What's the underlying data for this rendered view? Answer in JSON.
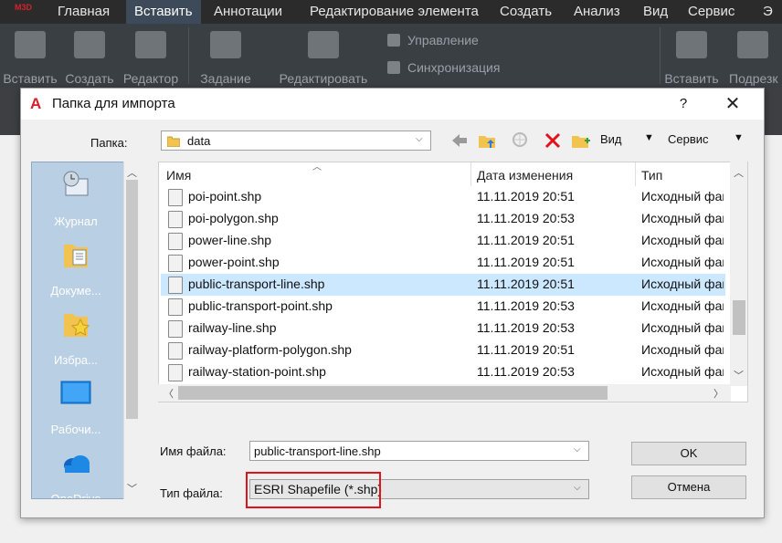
{
  "menubar": {
    "tabs": [
      "Главная",
      "Вставить",
      "Аннотации",
      "Редактирование элемента",
      "Создать",
      "Анализ",
      "Вид",
      "Сервис",
      "Э"
    ],
    "active_tab": "Вставить",
    "app_badge": "M3D"
  },
  "ribbon": {
    "buttons": [
      "Вставить",
      "Создать",
      "Редактор",
      "Задание",
      "Редактировать",
      "Вставить",
      "Подрезк"
    ],
    "small_items": [
      "Управление",
      "Синхронизация"
    ]
  },
  "dialog": {
    "title": "Папка для импорта",
    "help": "?",
    "close": "✕",
    "folder_label": "Папка:",
    "folder_value": "data",
    "toolbar": {
      "view_label": "Вид",
      "service_label": "Сервис"
    },
    "places": [
      "Журнал",
      "Докуме...",
      "Избра...",
      "Рабочи...",
      "OneDrive"
    ],
    "columns": {
      "name": "Имя",
      "date": "Дата изменения",
      "type": "Тип"
    },
    "files": [
      {
        "name": "poi-point.shp",
        "date": "11.11.2019 20:51",
        "type": "Исходный фай"
      },
      {
        "name": "poi-polygon.shp",
        "date": "11.11.2019 20:53",
        "type": "Исходный фай"
      },
      {
        "name": "power-line.shp",
        "date": "11.11.2019 20:51",
        "type": "Исходный фай"
      },
      {
        "name": "power-point.shp",
        "date": "11.11.2019 20:51",
        "type": "Исходный фай"
      },
      {
        "name": "public-transport-line.shp",
        "date": "11.11.2019 20:51",
        "type": "Исходный фай"
      },
      {
        "name": "public-transport-point.shp",
        "date": "11.11.2019 20:53",
        "type": "Исходный фай"
      },
      {
        "name": "railway-line.shp",
        "date": "11.11.2019 20:53",
        "type": "Исходный фай"
      },
      {
        "name": "railway-platform-polygon.shp",
        "date": "11.11.2019 20:51",
        "type": "Исходный фай"
      },
      {
        "name": "railway-station-point.shp",
        "date": "11.11.2019 20:53",
        "type": "Исходный фай"
      }
    ],
    "selected_file": "public-transport-line.shp",
    "filename_label": "Имя файла:",
    "filename_value": "public-transport-line.shp",
    "filetype_label": "Тип файла:",
    "filetype_value": "ESRI Shapefile  (*.shp)",
    "ok_label": "OK",
    "cancel_label": "Отмена"
  },
  "colors": {
    "highlight": "#e0121b",
    "selection": "#cce8ff",
    "places_bg": "#b9cfe4"
  }
}
